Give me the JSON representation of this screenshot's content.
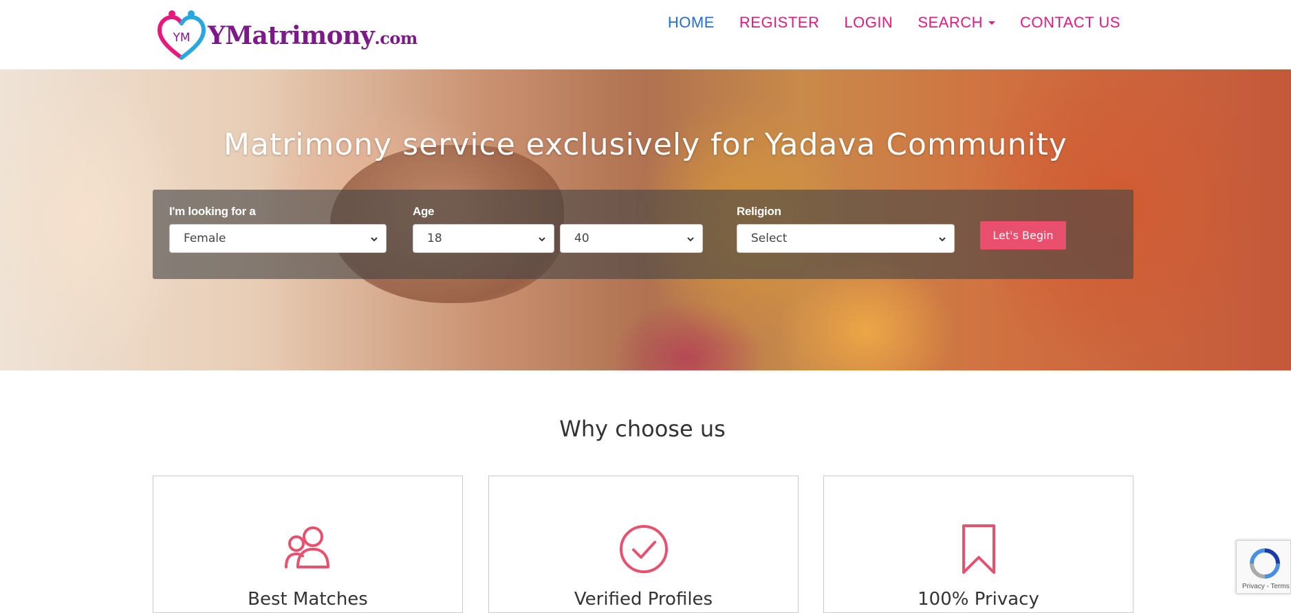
{
  "brand": {
    "logo_initials": "YM",
    "name": "YMatrimony",
    "suffix": ".com",
    "colors": {
      "primary_pink": "#e8197d",
      "logo_blue": "#29a8e0",
      "logo_purple": "#7d1a8a"
    }
  },
  "nav": {
    "items": [
      {
        "label": "HOME",
        "active": true
      },
      {
        "label": "REGISTER"
      },
      {
        "label": "LOGIN"
      },
      {
        "label": "SEARCH",
        "dropdown": true
      },
      {
        "label": "CONTACT US"
      }
    ],
    "active_color": "#1f6fd6"
  },
  "hero": {
    "title": "Matrimony service exclusively for Yadava Community",
    "search": {
      "looking_for_label": "I'm looking for a",
      "looking_for_value": "Female",
      "age_label": "Age",
      "age_min_value": "18",
      "age_max_value": "40",
      "religion_label": "Religion",
      "religion_value": "Select",
      "submit_label": "Let's Begin",
      "button_color": "#e8506e"
    }
  },
  "why": {
    "title": "Why choose us",
    "cards": [
      {
        "title": "Best Matches",
        "icon": "users-icon"
      },
      {
        "title": "Verified Profiles",
        "icon": "check-circle-icon"
      },
      {
        "title": "100% Privacy",
        "icon": "bookmark-icon"
      }
    ],
    "icon_color": "#e8506e"
  },
  "recaptcha": {
    "links": "Privacy - Terms"
  }
}
